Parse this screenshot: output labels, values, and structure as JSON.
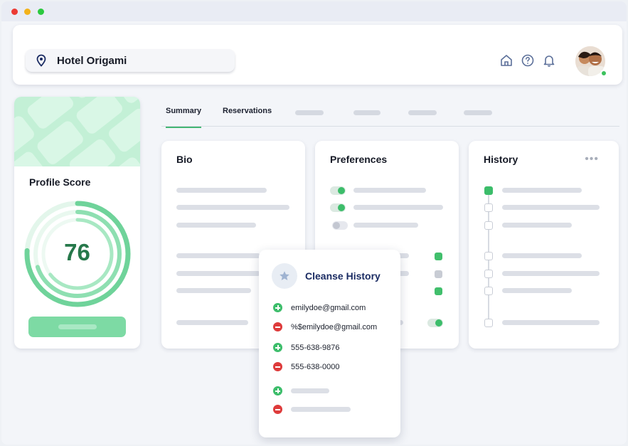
{
  "window": {
    "controls": [
      "close",
      "minimize",
      "maximize"
    ]
  },
  "header": {
    "hotel_name": "Hotel Origami",
    "icons": [
      "home-icon",
      "help-icon",
      "bell-icon"
    ],
    "user_status": "online"
  },
  "profile_score": {
    "title": "Profile Score",
    "score": "76",
    "ring_fill_fraction": 0.76
  },
  "tabs": [
    {
      "label": "Summary",
      "active": true
    },
    {
      "label": "Reservations",
      "active": false
    }
  ],
  "cards": {
    "bio": {
      "title": "Bio"
    },
    "preferences": {
      "title": "Preferences"
    },
    "history": {
      "title": "History"
    }
  },
  "cleanse_popup": {
    "title": "Cleanse History",
    "rows": [
      {
        "action": "add",
        "text": "emilydoe@gmail.com"
      },
      {
        "action": "remove",
        "text": "%$emilydoe@gmail.com"
      },
      {
        "action": "add",
        "text": "555-638-9876"
      },
      {
        "action": "remove",
        "text": "555-638-0000"
      }
    ]
  },
  "colors": {
    "accent_green": "#3cbd6a",
    "remove_red": "#de3b3b",
    "title_navy": "#1b2c63",
    "score_green": "#26784a"
  }
}
